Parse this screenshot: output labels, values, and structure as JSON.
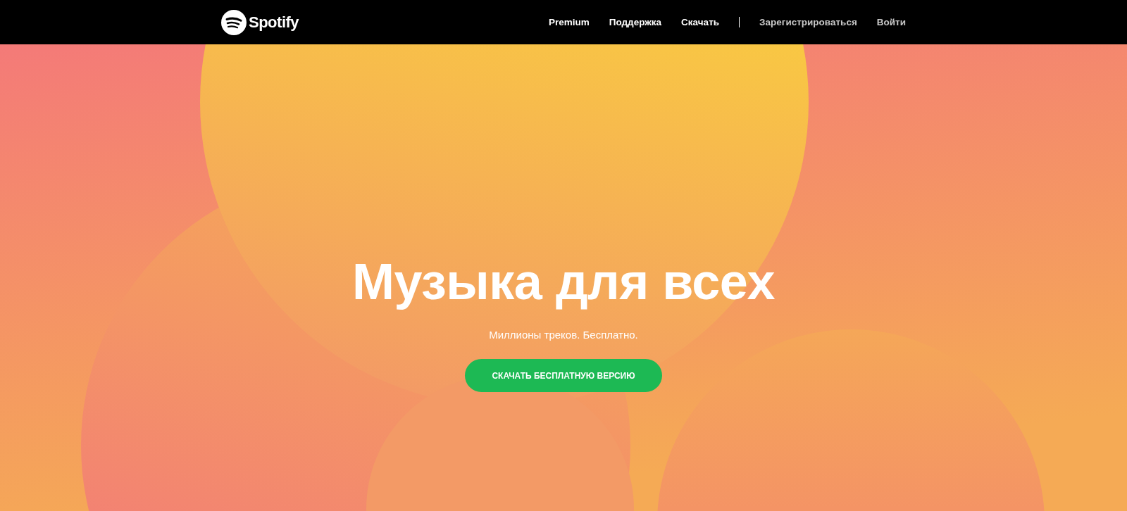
{
  "header": {
    "logo": "Spotify",
    "nav": [
      {
        "label": "Premium",
        "kind": "primary"
      },
      {
        "label": "Поддержка",
        "kind": "primary"
      },
      {
        "label": "Скачать",
        "kind": "primary"
      },
      {
        "label": "Зарегистрироваться",
        "kind": "secondary"
      },
      {
        "label": "Войти",
        "kind": "secondary"
      }
    ]
  },
  "hero": {
    "title": "Музыка для всех",
    "subtitle": "Миллионы треков. Бесплатно.",
    "button": "СКАЧАТЬ БЕСПЛАТНУЮ ВЕРСИЮ"
  }
}
